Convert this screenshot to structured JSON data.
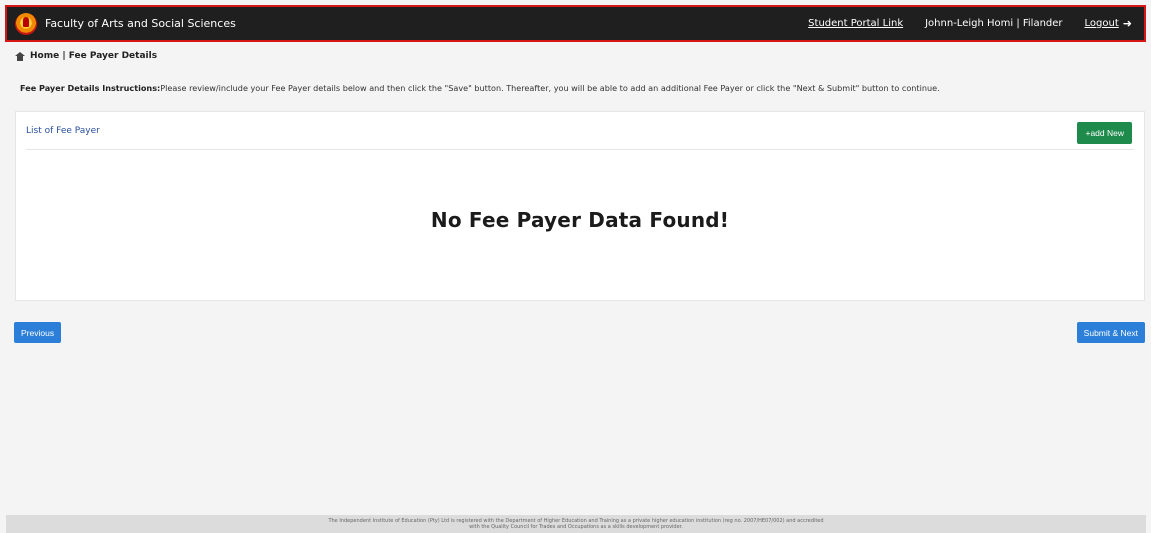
{
  "header": {
    "title": "Faculty of Arts and Social Sciences",
    "portal_link": "Student Portal Link",
    "user": "Johnn-Leigh Homi | Filander",
    "logout": "Logout"
  },
  "breadcrumb": {
    "text": "Home | Fee Payer Details"
  },
  "instructions": {
    "label": "Fee Payer Details Instructions:",
    "text": "Please review/include your Fee Payer details below and then click the \"Save\" button. Thereafter, you will be able to add an additional Fee Payer or click the \"Next & Submit\" button to continue."
  },
  "card": {
    "title": "List of Fee Payer",
    "add_button": "+add New",
    "empty_message": "No Fee Payer Data Found!"
  },
  "nav": {
    "previous": "Previous",
    "submit_next": "Submit & Next"
  },
  "footer": {
    "line1": "The Independent Institute of Education (Pty) Ltd is registered with the Department of Higher Education and Training as a private higher education institution (reg no. 2007/HE07/002) and accredited",
    "line2": "with the Quality Council for Trades and Occupations as a skills development provider."
  },
  "icons": {
    "logo": "faculty-logo",
    "home": "home-icon",
    "logout": "logout-icon"
  },
  "colors": {
    "header_bg": "#1f1f1f",
    "header_border": "#d91616",
    "add_button": "#1e8a4b",
    "nav_button": "#2b7fd8",
    "card_title": "#2a4f9e"
  }
}
